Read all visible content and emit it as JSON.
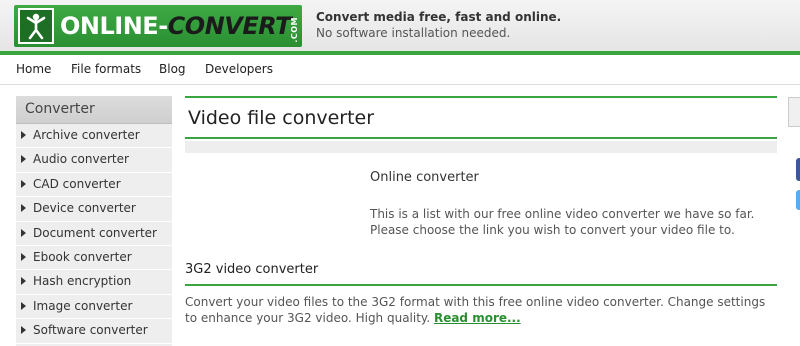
{
  "header": {
    "logo_word1": "ONLINE",
    "logo_dash": "-",
    "logo_word2": "CONVERT",
    "logo_dotcom": ".COM",
    "tagline_line1": "Convert media free, fast and online.",
    "tagline_line2": "No software installation needed."
  },
  "nav": {
    "items": [
      "Home",
      "File formats",
      "Blog",
      "Developers"
    ]
  },
  "sidebar": {
    "heading": "Converter",
    "items": [
      "Archive converter",
      "Audio converter",
      "CAD converter",
      "Device converter",
      "Document converter",
      "Ebook converter",
      "Hash encryption",
      "Image converter",
      "Software converter"
    ]
  },
  "main": {
    "title": "Video file converter",
    "online_heading": "Online converter",
    "online_text": "This is a list with our free online video converter we have so far. Please choose the link you wish to convert your video file to.",
    "section_heading": "3G2 video converter",
    "section_text": "Convert your video files to the 3G2 format with this free online video converter. Change settings to enhance your 3G2 video. High quality. ",
    "read_more": "Read more..."
  },
  "colors": {
    "brand_green": "#3aa43f",
    "sidebar_bg": "#eeeeee",
    "link_green": "#2a8f32"
  }
}
